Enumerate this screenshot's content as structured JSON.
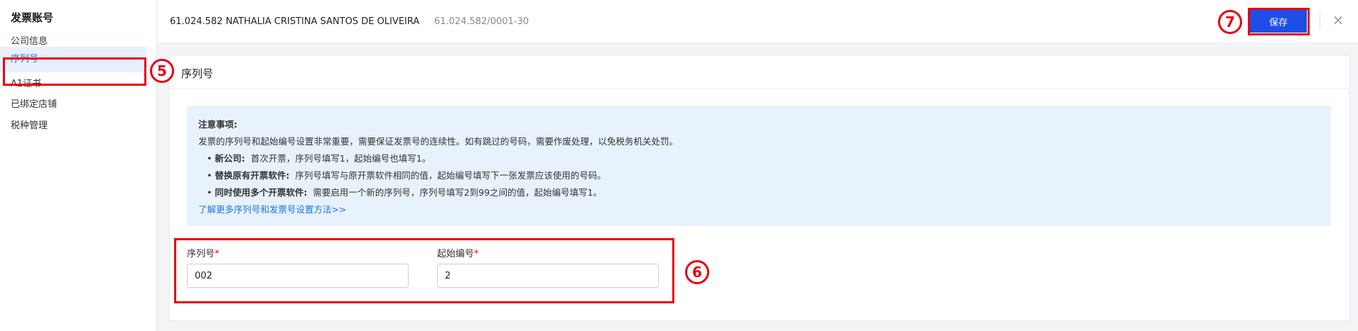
{
  "sidebar": {
    "title": "发票账号",
    "items": [
      {
        "label": "公司信息"
      },
      {
        "label": "序列号"
      },
      {
        "label": "A1证书"
      },
      {
        "label": "已绑定店铺"
      },
      {
        "label": "税种管理"
      }
    ]
  },
  "header": {
    "company_name": "61.024.582 NATHALIA CRISTINA SANTOS DE OLIVEIRA",
    "company_id": "61.024.582/0001-30",
    "save_label": "保存",
    "close_glyph": "×"
  },
  "annotations": {
    "step5": "5",
    "step6": "6",
    "step7": "7",
    "color": "#e60012"
  },
  "card": {
    "title": "序列号",
    "notice": {
      "title": "注意事项:",
      "description": "发票的序列号和起始编号设置非常重要，需要保证发票号的连续性。如有跳过的号码，需要作废处理，以免税务机关处罚。",
      "bullets": [
        {
          "bold": "新公司:",
          "text": "首次开票，序列号填写1，起始编号也填写1。"
        },
        {
          "bold": "替换原有开票软件:",
          "text": "序列号填写与原开票软件相同的值，起始编号填写下一张发票应该使用的号码。"
        },
        {
          "bold": "同时使用多个开票软件:",
          "text": "需要启用一个新的序列号，序列号填写2到99之间的值，起始编号填写1。"
        }
      ],
      "link": "了解更多序列号和发票号设置方法>>"
    },
    "fields": {
      "serial_label": "序列号",
      "serial_value": "002",
      "start_label": "起始编号",
      "start_value": "2",
      "required_mark": "*"
    }
  },
  "colors": {
    "accent": "#1d4fe8",
    "active_bg": "#e8f0fe",
    "active_text": "#1a73e8",
    "notice_bg": "#e8f2fc"
  }
}
